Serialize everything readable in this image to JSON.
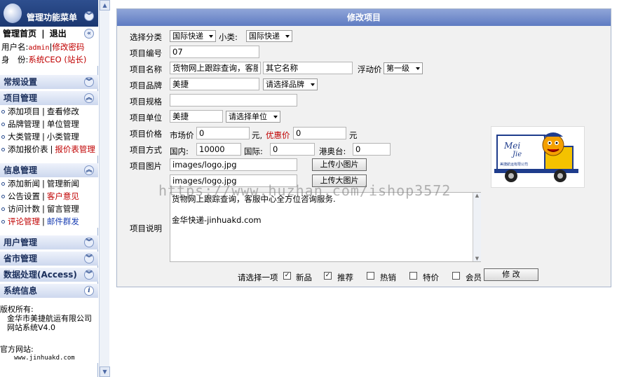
{
  "sidebar": {
    "title": "管理功能菜单",
    "title_collapse_icon": "double-chevron-down",
    "home_link": "管理首页",
    "divider": "|",
    "logout_link": "退出",
    "user_label": "用户名:",
    "user_value": "admin",
    "change_pwd": "修改密码",
    "role_label": "身　份:",
    "role_value": "系统CEO (站长)",
    "panels": {
      "general": "常规设置",
      "project": "项目管理",
      "info": "信息管理",
      "user": "用户管理",
      "city": "省市管理",
      "data": "数据处理(Access)",
      "sysinfo": "系统信息"
    },
    "project_items": [
      [
        "添加项目",
        "查看修改"
      ],
      [
        "品牌管理",
        "单位管理"
      ],
      [
        "大类管理",
        "小类管理"
      ],
      [
        "添加报价表",
        "报价表管理"
      ]
    ],
    "info_items": [
      [
        "添加新闻",
        "管理新闻"
      ],
      [
        "公告设置",
        "客户意见"
      ],
      [
        "访问计数",
        "留言管理"
      ],
      [
        "评论管理",
        "邮件群发"
      ]
    ],
    "copyright_label": "版权所有:",
    "copyright_value": "金华市美捷航运有限公司网站系统V4.0",
    "site_label": "官方网站:",
    "site_value": "www.jinhuakd.com"
  },
  "form": {
    "title": "修改项目",
    "category_label": "选择分类",
    "category_value": "国际快递",
    "subcategory_label": "小类:",
    "subcategory_value": "国际快递",
    "code_label": "项目编号",
    "code_value": "07",
    "name_label": "项目名称",
    "name_value": "货物网上跟踪查询，客服中",
    "other_name_value": "其它名称",
    "float_price_label": "浮动价",
    "float_price_value": "第一级",
    "brand_label": "项目品牌",
    "brand_value": "美捷",
    "brand_select": "请选择品牌",
    "spec_label": "项目规格",
    "spec_value": "",
    "unit_label": "项目单位",
    "unit_value": "美捷",
    "unit_select": "请选择单位",
    "price_label": "项目价格",
    "market_price_label": "市场价",
    "market_price_value": "0",
    "currency": "元,",
    "sale_price_label": "优惠价",
    "sale_price_value": "0",
    "currency2": "元",
    "mode_label": "项目方式",
    "domestic_label": "国内:",
    "domestic_value": "10000",
    "intl_label": "国际:",
    "intl_value": "0",
    "hkmo_label": "港奥台:",
    "hkmo_value": "0",
    "image_label": "项目图片",
    "small_img_value": "images/logo.jpg",
    "upload_small": "上传小图片",
    "large_img_value": "images/logo.jpg",
    "upload_large": "上传大图片",
    "desc_label": "项目说明",
    "desc_value": "货物网上跟踪查询，客服中心全方位咨询服务.\n\n金华快递-jinhuakd.com",
    "choose_label": "请选择一项",
    "checks": [
      {
        "label": "新品",
        "checked": true
      },
      {
        "label": "推荐",
        "checked": true
      },
      {
        "label": "热销",
        "checked": false
      },
      {
        "label": "特价",
        "checked": false
      },
      {
        "label": "会员",
        "checked": false
      }
    ],
    "submit": "修 改"
  },
  "logo_image": {
    "text_mei": "Mei",
    "text_jie": "Jie",
    "caption": "美捷航运有限公司"
  },
  "watermark": "https://www.huzhan.com/ishop3572"
}
